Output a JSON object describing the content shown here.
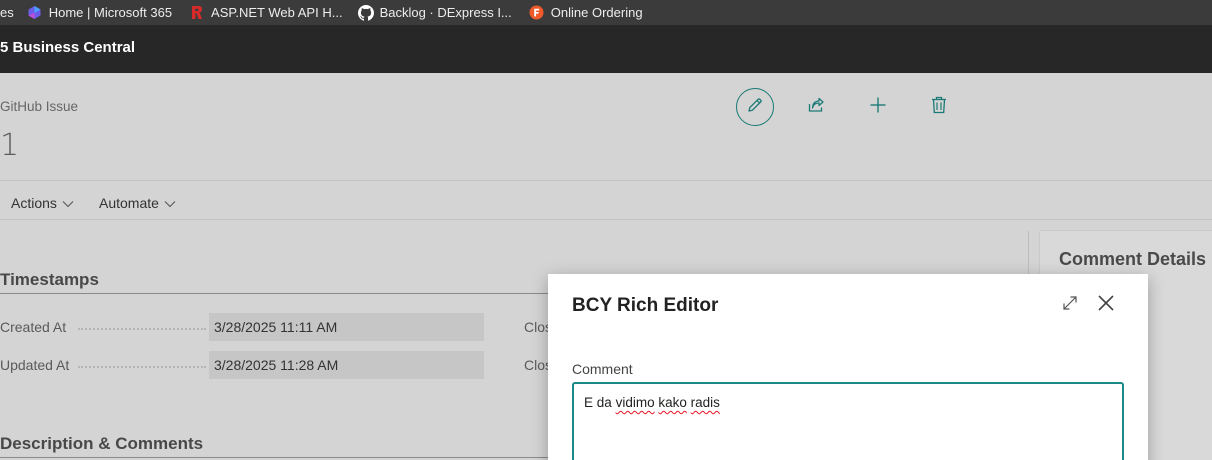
{
  "bookmarks": [
    {
      "label": "es",
      "icon": "bookmark-folder-icon"
    },
    {
      "label": "Home | Microsoft 365",
      "icon": "microsoft-365-icon"
    },
    {
      "label": "ASP.NET Web API H...",
      "icon": "asp-net-icon"
    },
    {
      "label": "Backlog · DExpress I...",
      "icon": "github-icon"
    },
    {
      "label": "Online Ordering",
      "icon": "online-ordering-icon"
    }
  ],
  "app": {
    "title": "5 Business Central"
  },
  "page": {
    "caption": "GitHub Issue",
    "number": "1",
    "actions": [
      {
        "name": "edit",
        "icon": "pencil-icon"
      },
      {
        "name": "share",
        "icon": "share-icon"
      },
      {
        "name": "new",
        "icon": "plus-icon"
      },
      {
        "name": "delete",
        "icon": "trash-icon"
      }
    ],
    "menu": [
      {
        "label": "Actions",
        "icon": "chevron-down-icon"
      },
      {
        "label": "Automate",
        "icon": "chevron-down-icon"
      }
    ]
  },
  "timestamps": {
    "title": "Timestamps",
    "fields": [
      {
        "label": "Created At",
        "value": "3/28/2025 11:11 AM",
        "side_label": "Clos"
      },
      {
        "label": "Updated At",
        "value": "3/28/2025 11:28 AM",
        "side_label": "Clos"
      }
    ]
  },
  "description": {
    "title": "Description & Comments"
  },
  "factbox": {
    "title": "Comment Details"
  },
  "dialog": {
    "title": "BCY Rich Editor",
    "comment_label": "Comment",
    "comment_words": [
      "E",
      "da",
      "vidimo",
      "kako",
      "radis"
    ]
  },
  "colors": {
    "accent": "#1b8a84",
    "header": "#272727",
    "bookmarks_bar": "#3b3b3b",
    "page_bg": "#d4d4d4"
  }
}
